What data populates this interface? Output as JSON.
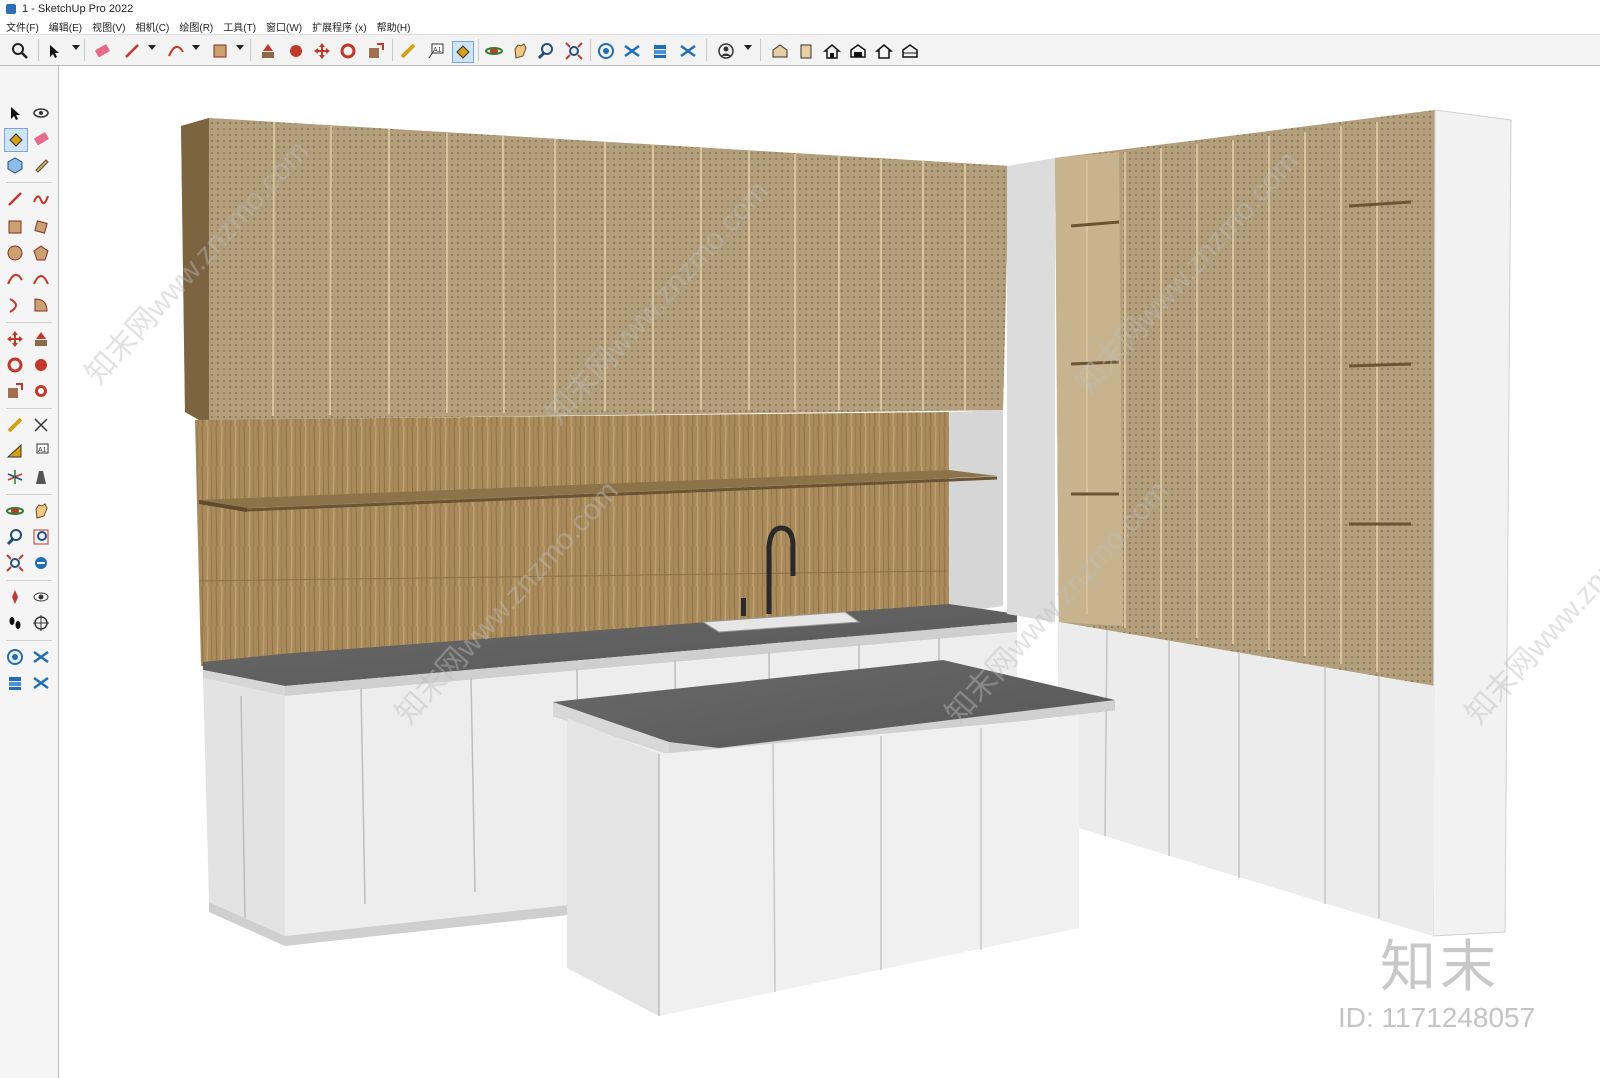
{
  "window": {
    "title": "1 - SketchUp Pro 2022"
  },
  "menu": [
    "文件(F)",
    "编辑(E)",
    "视图(V)",
    "相机(C)",
    "绘图(R)",
    "工具(T)",
    "窗口(W)",
    "扩展程序 (x)",
    "帮助(H)"
  ],
  "toolbar": {
    "icons": [
      "search-icon",
      "select-icon",
      "eraser-icon",
      "pencil-icon",
      "arc-icon",
      "rectangle-icon",
      "push-pull-icon",
      "follow-me-icon",
      "move-icon",
      "rotate-icon",
      "scale-icon",
      "tape-measure-icon",
      "text-icon",
      "paint-bucket-icon",
      "orbit-icon",
      "pan-icon",
      "zoom-icon",
      "zoom-extents-icon",
      "warehouse-icon",
      "extension-warehouse-icon",
      "layout-icon",
      "send-to-layout-icon",
      "user-icon",
      "iso-view-icon",
      "top-view-icon",
      "front-view-icon",
      "right-view-icon",
      "back-view-icon",
      "left-view-icon"
    ]
  },
  "sidebar": {
    "icons": [
      "select-icon",
      "orbit-icon",
      "paint-bucket-icon",
      "eraser-icon",
      "component-icon",
      "tape-icon",
      "line-icon",
      "freehand-icon",
      "rectangle-icon",
      "rotated-rectangle-icon",
      "circle-icon",
      "polygon-icon",
      "arc-icon",
      "arc-2pt-icon",
      "arc-3pt-icon",
      "pie-icon",
      "move-icon",
      "push-pull-icon",
      "rotate-icon",
      "follow-me-icon",
      "scale-icon",
      "offset-icon",
      "tape-measure-icon",
      "dimension-icon",
      "protractor-icon",
      "text-icon",
      "axes-icon",
      "3d-text-icon",
      "orbit-icon",
      "pan-icon",
      "zoom-icon",
      "zoom-window-icon",
      "zoom-extents-icon",
      "previous-icon",
      "position-camera-icon",
      "look-around-icon",
      "walk-icon",
      "section-plane-icon",
      "warehouse-icon",
      "extension-icon",
      "layout-icon",
      "send-icon"
    ]
  },
  "watermark": {
    "brand": "知末",
    "id_text": "ID: 1171248057",
    "site": "知末网www.znzmo.com"
  },
  "colors": {
    "wood": "#a88a5c",
    "wood_dark": "#7c6440",
    "mesh": "#b7a27d",
    "cabinet_white": "#ececec",
    "counter_gray": "#5f5f5f"
  }
}
